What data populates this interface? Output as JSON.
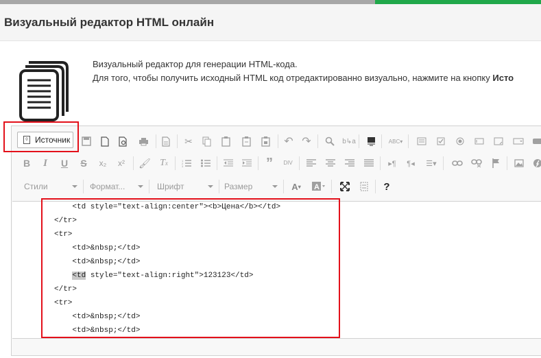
{
  "page": {
    "title": "Визуальный редактор HTML онлайн"
  },
  "intro": {
    "line1": "Визуальный редактор для генерации HTML-кода.",
    "line2_prefix": "Для того, чтобы получить исходный HTML код отредактированно визуально, нажмите на кнопку ",
    "line2_bold": "Исто"
  },
  "toolbar": {
    "source_label": "Источник",
    "row1_icons": [
      "save-icon",
      "new-page-icon",
      "preview-icon",
      "print-icon",
      "templates-icon",
      "cut-icon",
      "copy-icon",
      "paste-icon",
      "paste-text-icon",
      "paste-word-icon",
      "undo-icon",
      "redo-icon",
      "find-icon",
      "replace-icon",
      "select-all-icon",
      "spellcheck-icon",
      "form-icon",
      "checkbox-icon",
      "radio-icon",
      "textfield-icon",
      "textarea-icon",
      "select-field-icon"
    ],
    "row2_icons": [
      "bold-icon",
      "italic-icon",
      "underline-icon",
      "strikethrough-icon",
      "subscript-icon",
      "superscript-icon",
      "copy-format-icon",
      "remove-format-icon",
      "numbered-list-icon",
      "bulleted-list-icon",
      "decrease-indent-icon",
      "increase-indent-icon",
      "blockquote-icon",
      "div-icon",
      "align-left-icon",
      "align-center-icon",
      "align-right-icon",
      "justify-icon",
      "ltr-icon",
      "rtl-icon",
      "language-icon",
      "link-icon",
      "unlink-icon",
      "anchor-icon",
      "image-icon",
      "flash-icon"
    ],
    "combos": {
      "styles": "Стили",
      "format": "Формат...",
      "font": "Шрифт",
      "size": "Размер"
    },
    "row3_icons": [
      "text-color-icon",
      "bg-color-icon",
      "maximize-icon",
      "show-blocks-icon",
      "help-icon"
    ],
    "help_label": "?"
  },
  "code": {
    "lines": [
      "    <td style=\"text-align:center\"><b>Цена</b></td>",
      "</tr>",
      "<tr>",
      "    <td>&nbsp;</td>",
      "    <td>&nbsp;</td>",
      "    ",
      "</tr>",
      "<tr>",
      "    <td>&nbsp;</td>",
      "    <td>&nbsp;</td>"
    ],
    "highlight_token": "<td",
    "highlight_rest": " style=\"text-align:right\">123123</td>"
  },
  "colors": {
    "annotation": "#e3101a",
    "accent": "#20a84a"
  }
}
